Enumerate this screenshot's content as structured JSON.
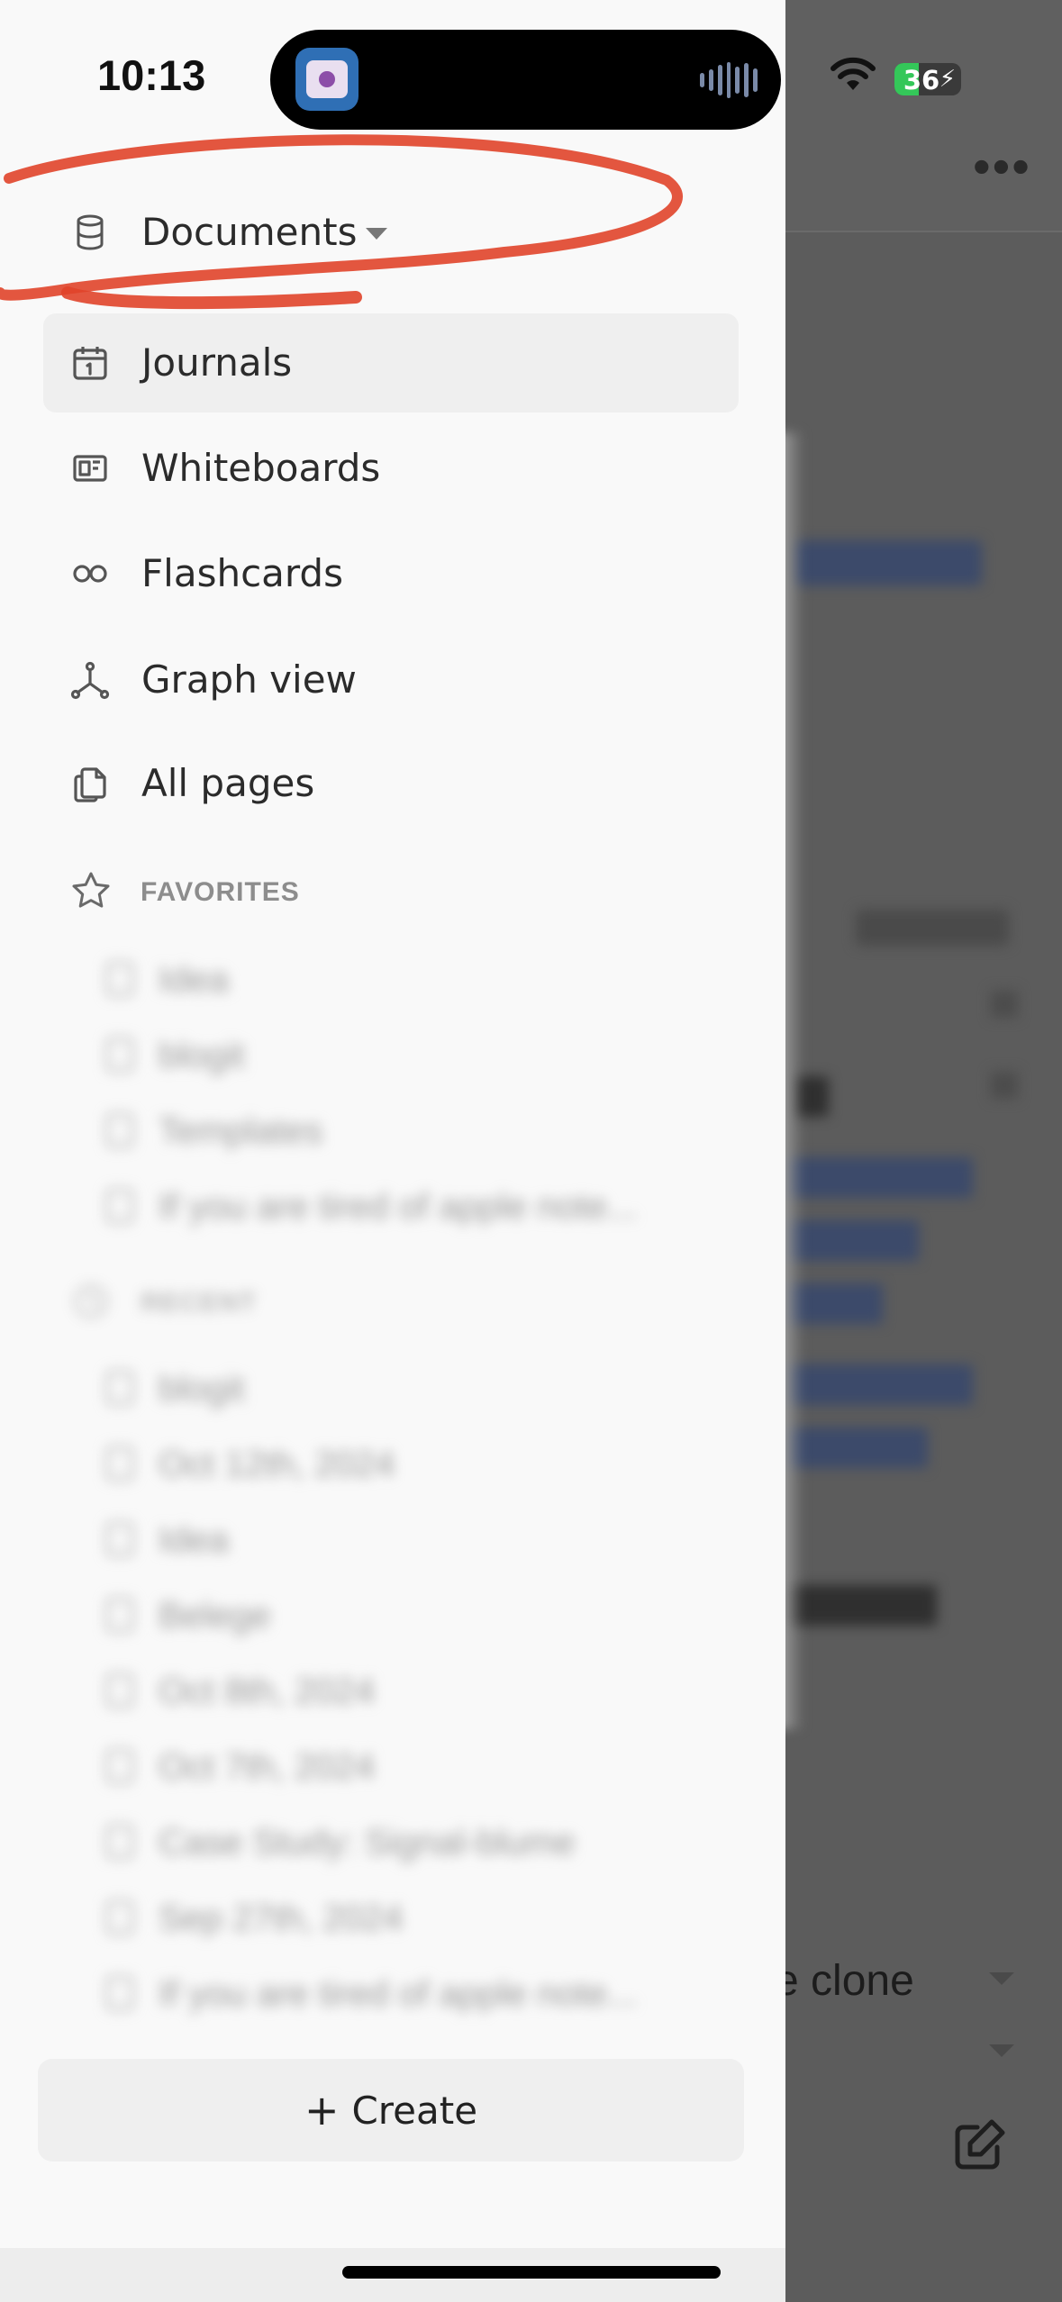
{
  "status_bar": {
    "time": "10:13",
    "battery_level": "36",
    "battery_fraction": 0.36,
    "wifi_icon": "wifi-icon",
    "charging_icon": "bolt-icon"
  },
  "background_app": {
    "menu_icon": "more-horizontal-icon",
    "partial_text": "e clone",
    "edit_icon": "compose-icon"
  },
  "sidebar": {
    "graph_switcher": {
      "label": "Documents",
      "icon": "database-icon",
      "caret_icon": "caret-down-icon"
    },
    "nav": [
      {
        "label": "Journals",
        "icon": "calendar-icon",
        "selected": true
      },
      {
        "label": "Whiteboards",
        "icon": "whiteboard-icon"
      },
      {
        "label": "Flashcards",
        "icon": "infinity-icon"
      },
      {
        "label": "Graph view",
        "icon": "graph-icon"
      },
      {
        "label": "All pages",
        "icon": "pages-icon"
      }
    ],
    "favorites": {
      "header": "FAVORITES",
      "icon": "star-icon",
      "items": [
        "Idea",
        "blogit",
        "Templates",
        "If you are tired of apple note..."
      ]
    },
    "recent": {
      "header": "RECENT",
      "icon": "clock-icon",
      "items": [
        "blogit",
        "Oct 12th, 2024",
        "Idea",
        "Belege",
        "Oct 8th, 2024",
        "Oct 7th, 2024",
        "Case Study: Signal-blume",
        "Sep 27th, 2024",
        "If you are tired of apple note..."
      ]
    },
    "create_button": {
      "plus": "+",
      "label": "Create"
    }
  },
  "annotation": {
    "color": "#e0442a",
    "shape": "hand-drawn-ellipse"
  }
}
